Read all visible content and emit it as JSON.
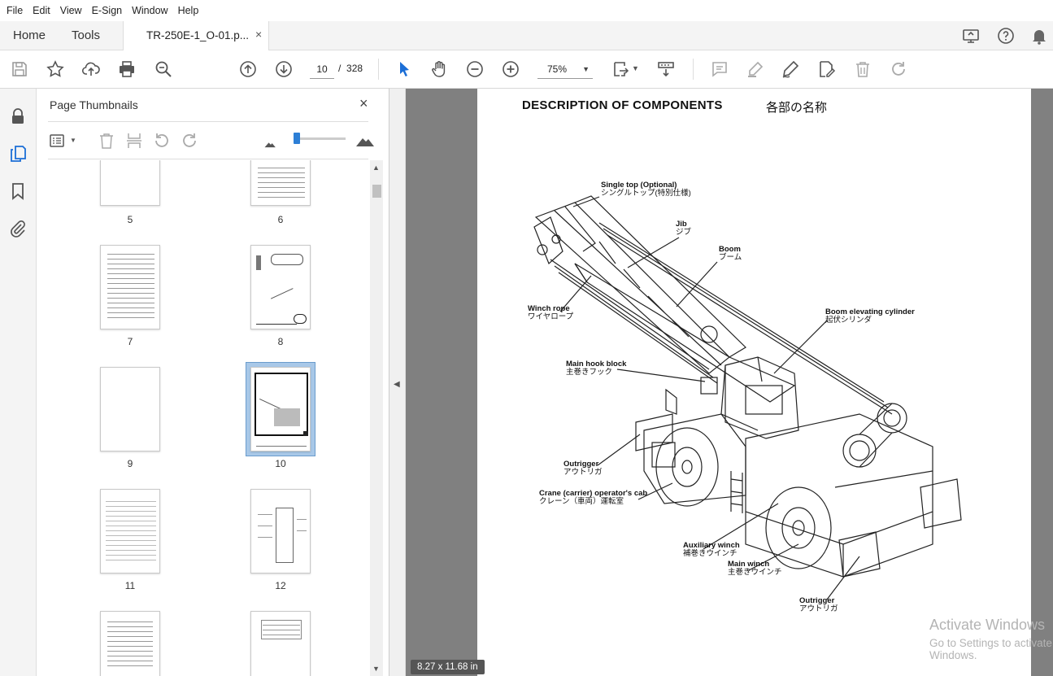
{
  "menu": [
    "File",
    "Edit",
    "View",
    "E-Sign",
    "Window",
    "Help"
  ],
  "tabs": {
    "home": "Home",
    "tools": "Tools",
    "document": "TR-250E-1_O-01.p...",
    "close": "×"
  },
  "toolbar": {
    "current_page": "10",
    "page_separator": "/",
    "total_pages": "328",
    "zoom": "75%"
  },
  "panel": {
    "title": "Page Thumbnails",
    "close": "×",
    "thumbnails": [
      {
        "label": "5"
      },
      {
        "label": "6"
      },
      {
        "label": "7"
      },
      {
        "label": "8"
      },
      {
        "label": "9"
      },
      {
        "label": "10"
      },
      {
        "label": "11"
      },
      {
        "label": "12"
      },
      {
        "label": ""
      },
      {
        "label": ""
      }
    ],
    "selected_page": "10"
  },
  "document": {
    "title": "DESCRIPTION OF COMPONENTS",
    "title_jp": "各部の名称",
    "callouts": [
      {
        "en": "Single top (Optional)",
        "jp": "シングルトップ(特別仕様)"
      },
      {
        "en": "Jib",
        "jp": "ジブ"
      },
      {
        "en": "Boom",
        "jp": "ブーム"
      },
      {
        "en": "Winch rope",
        "jp": "ワイヤロープ"
      },
      {
        "en": "Boom elevating cylinder",
        "jp": "起伏シリンダ"
      },
      {
        "en": "Main hook block",
        "jp": "主巻きフック"
      },
      {
        "en": "Outrigger",
        "jp": "アウトリガ"
      },
      {
        "en": "Crane (carrier) operator's cab",
        "jp": "クレーン（車両）運転室"
      },
      {
        "en": "Auxiliary winch",
        "jp": "補巻きウインチ"
      },
      {
        "en": "Main winch",
        "jp": "主巻きウインチ"
      },
      {
        "en": "Outrigger",
        "jp": "アウトリガ"
      }
    ],
    "page_size": "8.27 x 11.68 in"
  },
  "watermark": {
    "line1": "Activate Windows",
    "line2": "Go to Settings to activate Windows."
  }
}
